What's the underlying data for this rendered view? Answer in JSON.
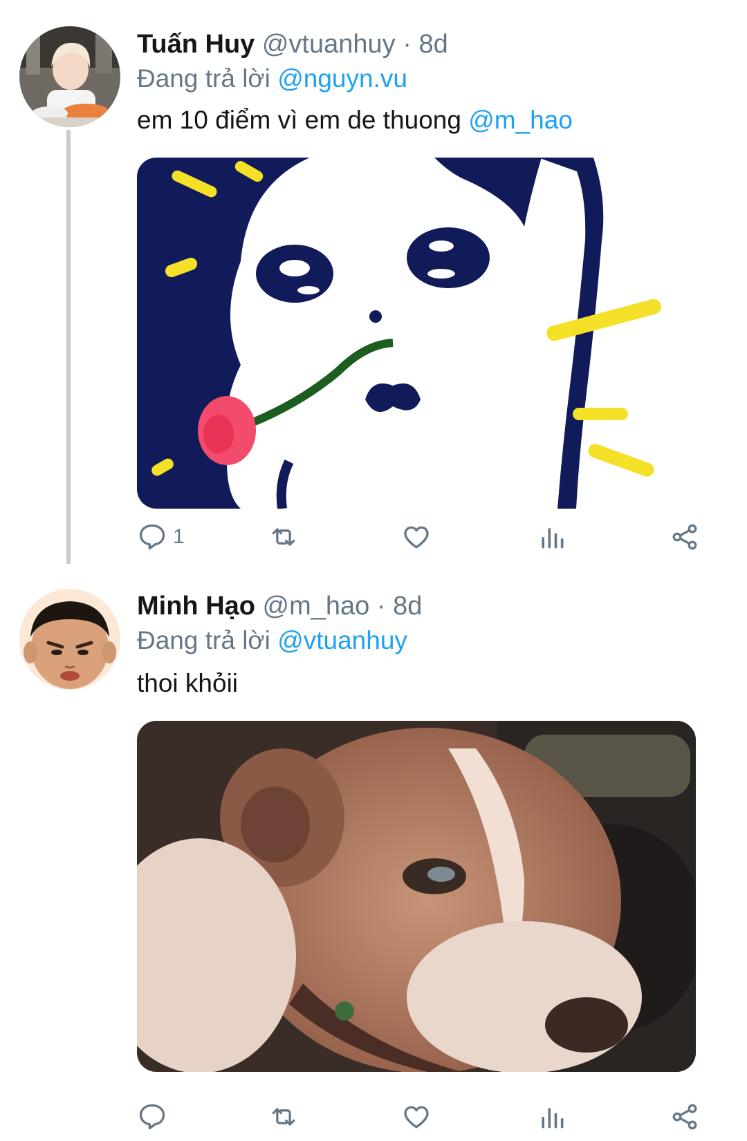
{
  "tweets": [
    {
      "name": "Tuấn Huy",
      "handle": "@vtuanhuy",
      "separator": "·",
      "time": "8d",
      "reply_prefix": "Đang trả lời",
      "reply_mention": "@nguyn.vu",
      "text": "em 10 điểm vì em de thuong ",
      "text_mention": "@m_hao",
      "media": "cartoon-cat-with-rose",
      "reply_count": "1",
      "has_thread_line": true
    },
    {
      "name": "Minh Hạo",
      "handle": "@m_hao",
      "separator": "·",
      "time": "8d",
      "reply_prefix": "Đang trả lời",
      "reply_mention": "@vtuanhuy",
      "text": "thoi khỏii",
      "text_mention": "",
      "media": "side-eye-dog",
      "reply_count": "",
      "has_thread_line": false
    }
  ],
  "icons": {
    "reply": "reply-icon",
    "retweet": "retweet-icon",
    "like": "heart-icon",
    "stats": "analytics-icon",
    "share": "share-icon",
    "more": "more-vertical-icon"
  },
  "colors": {
    "mention": "#1da1f2",
    "secondary_text": "#657786",
    "primary_text": "#14171a",
    "thread_line": "#c7cdd2"
  }
}
